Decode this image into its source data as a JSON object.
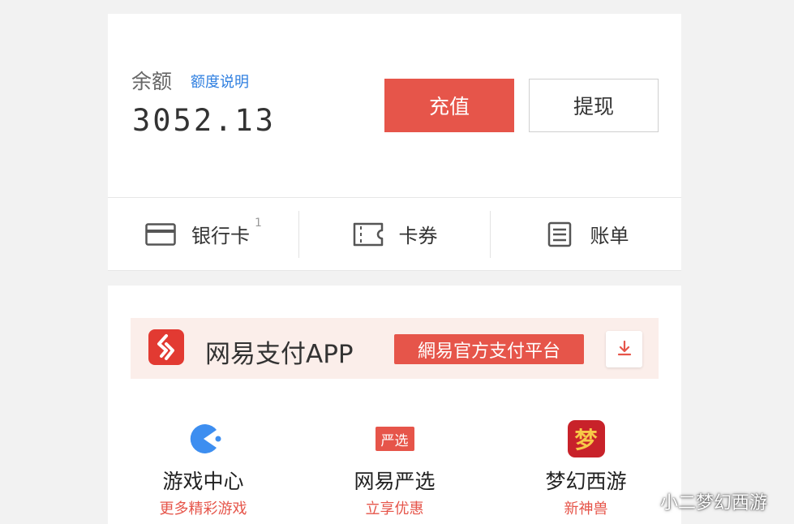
{
  "balance": {
    "label": "余额",
    "quota_link": "额度说明",
    "amount": "3052.13",
    "recharge_label": "充值",
    "withdraw_label": "提现"
  },
  "quick_links": [
    {
      "label": "银行卡",
      "badge": "1",
      "icon": "bank-card-icon"
    },
    {
      "label": "卡券",
      "icon": "coupon-icon"
    },
    {
      "label": "账单",
      "icon": "bill-icon"
    }
  ],
  "promo": {
    "title": "网易支付APP",
    "tag": "網易官方支付平台",
    "logo_icon": "netease-pay-logo",
    "download_icon": "download-icon"
  },
  "services": [
    {
      "name": "游戏中心",
      "subtitle": "更多精彩游戏",
      "icon": "game-center-icon"
    },
    {
      "name": "网易严选",
      "subtitle": "立享优惠",
      "icon": "yanxuan-icon",
      "icon_text": "严选"
    },
    {
      "name": "梦幻西游",
      "subtitle": "新神兽",
      "icon": "menghuan-icon",
      "icon_text": "梦"
    }
  ],
  "watermark": "小二梦幻西游",
  "colors": {
    "accent": "#e6554a",
    "link": "#2f7fe0",
    "promo_bg": "#fbeeea"
  }
}
